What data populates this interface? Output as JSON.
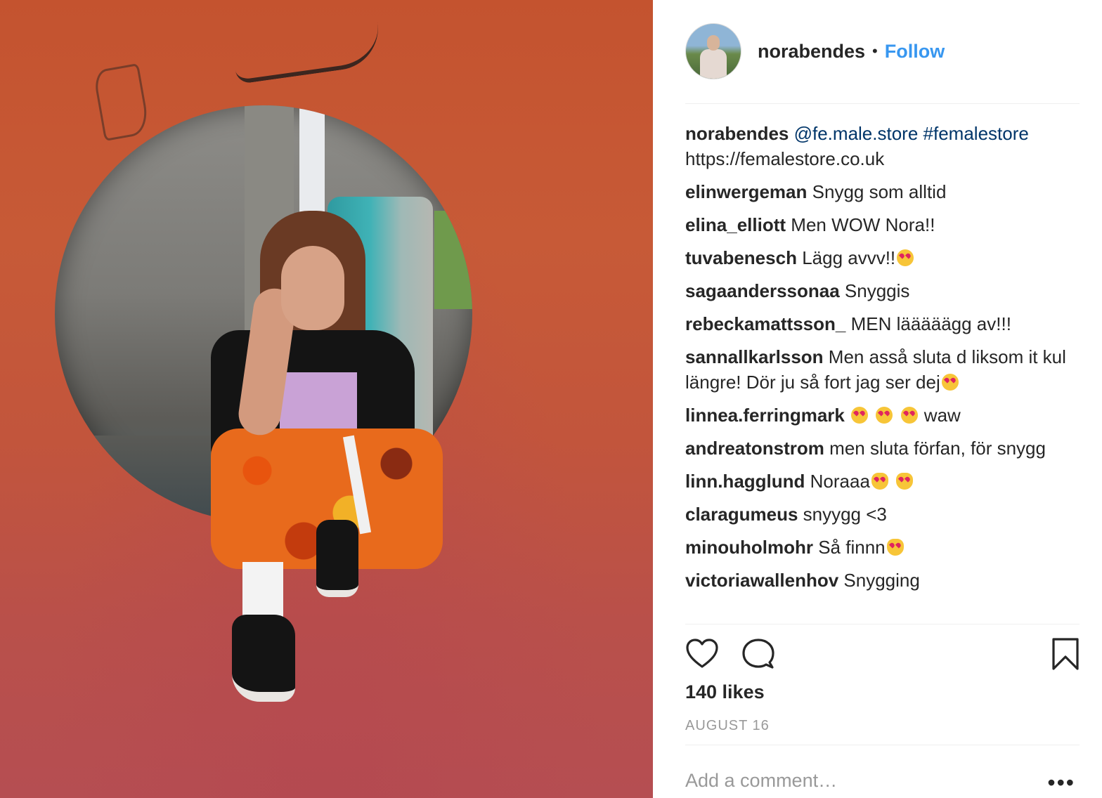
{
  "post": {
    "image_alt": "Girl crouching inside a red concrete pipe"
  },
  "header": {
    "username": "norabendes",
    "separator": "•",
    "follow_label": "Follow"
  },
  "caption": {
    "user": "norabendes",
    "mention": "@fe.male.store",
    "hashtag": "#femalestore",
    "link": "https://femalestore.co.uk"
  },
  "comments": [
    {
      "user": "elinwergeman",
      "text": "Snygg som alltid"
    },
    {
      "user": "elina_elliott",
      "text": "Men WOW Nora!!"
    },
    {
      "user": "tuvabenesch",
      "text": "Lägg avvv!!",
      "emojis": [
        "heart-eyes"
      ]
    },
    {
      "user": "sagaanderssonaa",
      "text": "Snyggis"
    },
    {
      "user": "rebeckamattsson_",
      "text": "MEN lääääägg av!!!"
    },
    {
      "user": "sannallkarlsson",
      "text": "Men asså sluta d liksom it kul längre! Dör ju så fort jag ser dej",
      "emojis": [
        "heart-eyes"
      ]
    },
    {
      "user": "linnea.ferringmark",
      "text": "waw",
      "emojis_before": [
        "heart-eyes",
        "heart-eyes",
        "heart-eyes"
      ]
    },
    {
      "user": "andreatonstrom",
      "text": "men sluta förfan, för snygg"
    },
    {
      "user": "linn.hagglund",
      "text": "Noraaa",
      "emojis": [
        "heart-eyes-cat",
        "heart-eyes-cat"
      ]
    },
    {
      "user": "claragumeus",
      "text": "snyygg <3"
    },
    {
      "user": "minouholmohr",
      "text": "Så finnn",
      "emojis": [
        "heart-eyes-cat"
      ]
    },
    {
      "user": "victoriawallenhov",
      "text": "Snygging"
    }
  ],
  "actions": {
    "like_icon": "heart-icon",
    "comment_icon": "comment-icon",
    "save_icon": "bookmark-icon"
  },
  "likes": "140 likes",
  "date": "AUGUST 16",
  "add_comment": {
    "placeholder": "Add a comment…",
    "more_icon": "ellipsis-icon"
  },
  "colors": {
    "link_blue": "#3897f0",
    "mention_blue": "#003569",
    "text": "#262626",
    "muted": "#999999"
  }
}
